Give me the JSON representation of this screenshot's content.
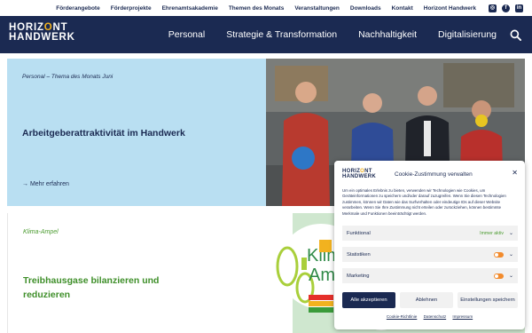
{
  "topbar": {
    "links": [
      "Förderangebote",
      "Förderprojekte",
      "Ehrenamtsakademie",
      "Themen des Monats",
      "Veranstaltungen",
      "Downloads",
      "Kontakt",
      "Horizont Handwerk"
    ],
    "social": [
      {
        "icon": "instagram-icon",
        "glyph": "◎"
      },
      {
        "icon": "facebook-icon",
        "glyph": "f"
      },
      {
        "icon": "linkedin-icon",
        "glyph": "in"
      }
    ]
  },
  "header": {
    "logo_line1_a": "HORIZ",
    "logo_line1_o": "O",
    "logo_line1_b": "NT",
    "logo_line2": "HANDWERK",
    "nav": [
      "Personal",
      "Strategie & Transformation",
      "Nachhaltigkeit",
      "Digitalisierung"
    ],
    "search_icon": "search-icon"
  },
  "hero": {
    "tag": "Personal – Thema des Monats Juni",
    "title": "Arbeitgeberattraktivität im Handwerk",
    "more": "→ Mehr erfahren"
  },
  "card2": {
    "tag": "Klima-Ampel",
    "title": "Treibhausgase bilanzieren und reduzieren",
    "illustration_text_1": "Klima-",
    "illustration_text_2": "Ampel"
  },
  "cookie": {
    "logo_a": "HORIZ",
    "logo_o": "O",
    "logo_b": "NT",
    "logo_line2": "HANDWERK",
    "title": "Cookie-Zustimmung verwalten",
    "close": "✕",
    "text": "Um ein optimales Erlebnis zu bieten, verwenden wir Technologien wie Cookies, um Geräteinformationen zu speichern und/oder darauf zuzugreifen. Wenn Sie diesen Technologien zustimmen, können wir Daten wie das Surfverhalten oder eindeutige IDs auf dieser Website verarbeiten. Wenn Sie Ihre Zustimmung nicht erteilen oder zurückziehen, können bestimmte Merkmale und Funktionen beeinträchtigt werden.",
    "rows": [
      {
        "label": "Funktional",
        "status": "Immer aktiv"
      },
      {
        "label": "Statistiken"
      },
      {
        "label": "Marketing"
      }
    ],
    "accept": "Alle akzeptieren",
    "reject": "Ablehnen",
    "settings": "Einstellungen speichern",
    "links": [
      "Cookie-Richtlinie",
      "Datenschutz",
      "Impressum"
    ],
    "colors": {
      "primary": "#1b2a52",
      "toggle": "#f28b2d",
      "accent": "#f2b21f"
    }
  }
}
